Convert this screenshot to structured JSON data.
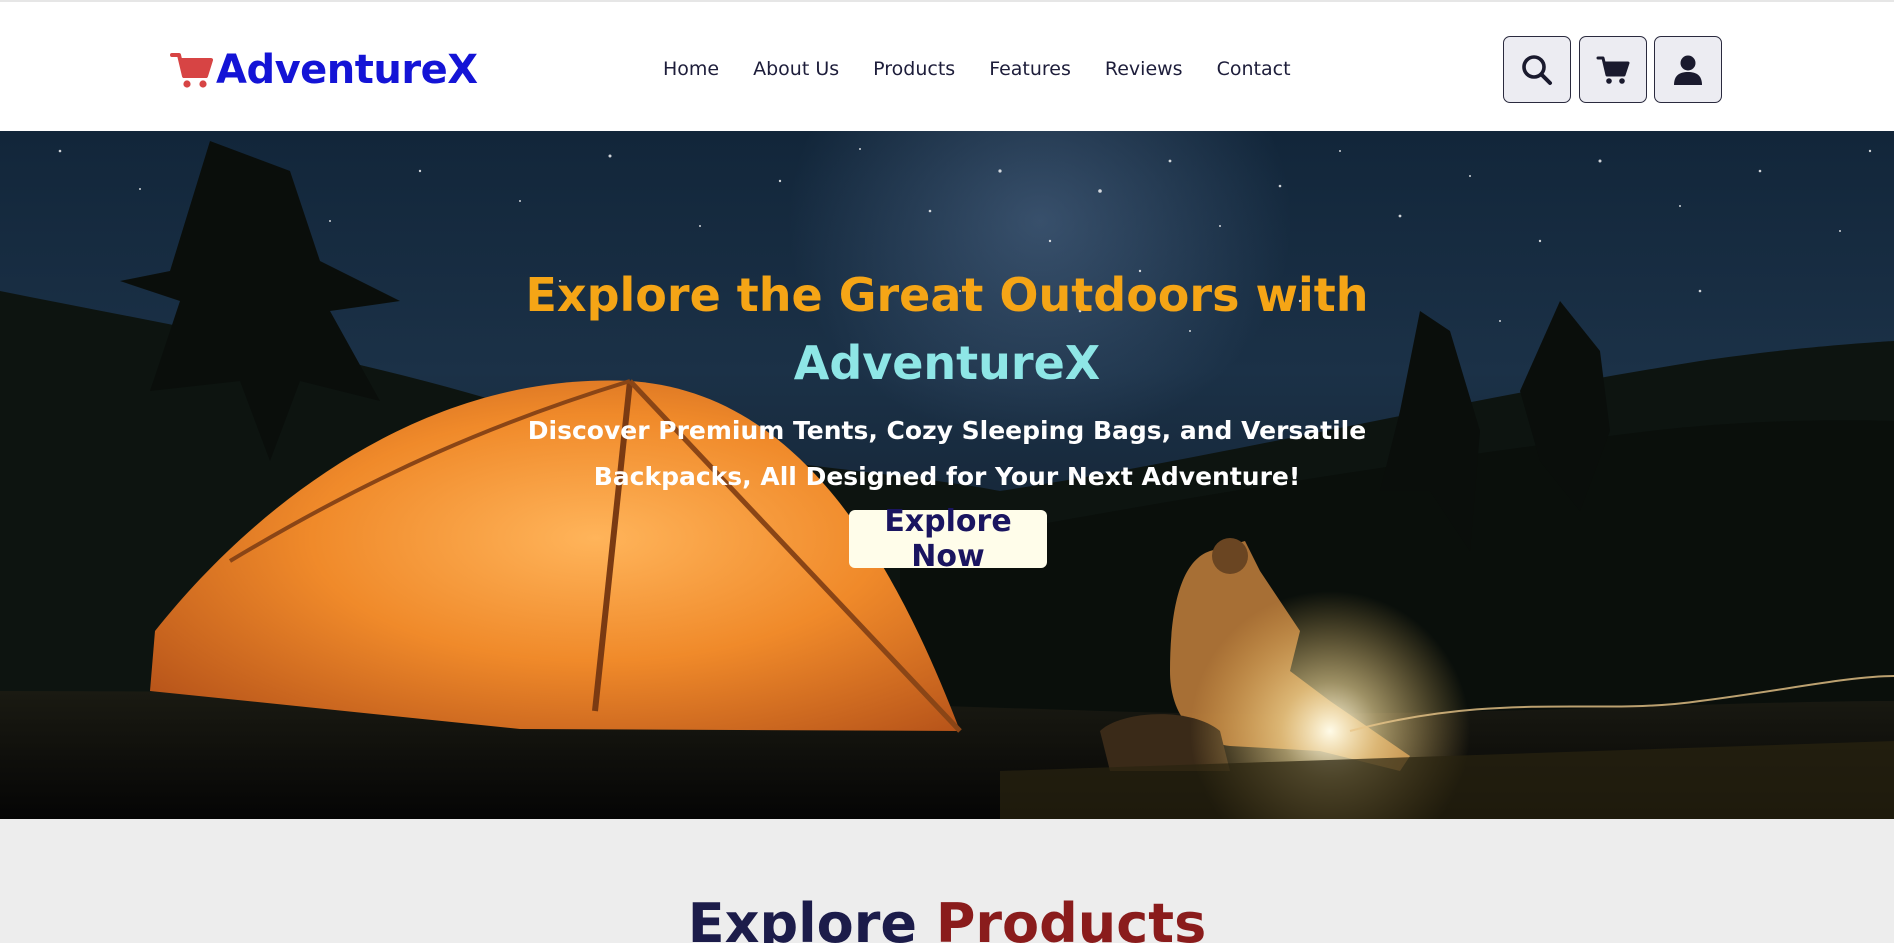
{
  "brand": {
    "name": "AdventureX",
    "color": "#1414d6",
    "cart_color": "#d74444"
  },
  "nav": {
    "items": [
      "Home",
      "About Us",
      "Products",
      "Features",
      "Reviews",
      "Contact"
    ]
  },
  "header_icons": [
    "search-icon",
    "cart-icon",
    "user-icon"
  ],
  "hero": {
    "title": "Explore the Great Outdoors with",
    "title_brand": "AdventureX",
    "subtitle_line1": "Discover Premium Tents, Cozy Sleeping Bags, and Versatile",
    "subtitle_line2": "Backpacks, All Designed for Your Next Adventure!",
    "cta": "Explore Now",
    "colors": {
      "title": "#f5a516",
      "title_brand": "#8ee6e6",
      "subtitle": "#ffffff"
    }
  },
  "section": {
    "title_part1": "Explore",
    "title_part2": "Products"
  }
}
